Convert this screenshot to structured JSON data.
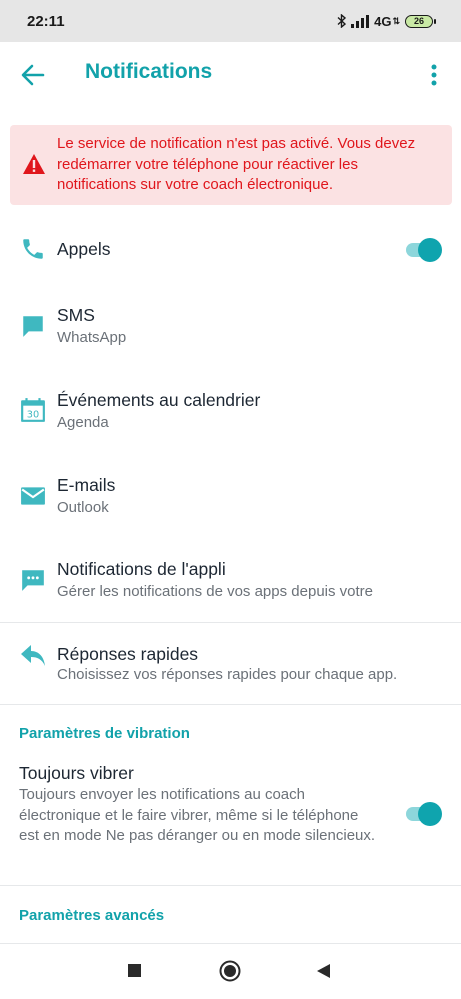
{
  "status": {
    "time": "22:11",
    "network": "4G",
    "battery": "26",
    "icons": [
      "bluetooth-icon",
      "signal-icon",
      "battery-icon"
    ]
  },
  "header": {
    "title": "Notifications",
    "back_icon": "arrow-back-icon",
    "menu_icon": "more-vert-icon"
  },
  "alert": {
    "text": "Le service de notification n'est pas activé. Vous devez redémarrer votre téléphone pour réactiver les notifications sur votre coach électronique.",
    "icon": "warning-icon",
    "color": "#e0161c",
    "background": "#fbe2e3"
  },
  "items": [
    {
      "label": "Appels",
      "sub": "",
      "icon": "phone-icon",
      "toggle": true
    },
    {
      "label": "SMS",
      "sub": "WhatsApp",
      "icon": "message-icon"
    },
    {
      "label": "Événements au calendrier",
      "sub": "Agenda",
      "icon": "calendar-icon",
      "icon_text": "30"
    },
    {
      "label": "E-mails",
      "sub": "Outlook",
      "icon": "email-icon"
    },
    {
      "label": "Notifications de l'appli",
      "sub": "Gérer les notifications de vos apps depuis votre",
      "icon": "chat-dots-icon"
    },
    {
      "label": "Réponses rapides",
      "sub": "Choisissez vos réponses rapides pour chaque app.",
      "icon": "reply-icon"
    }
  ],
  "vibration": {
    "section_title": "Paramètres de vibration",
    "label": "Toujours vibrer",
    "description": "Toujours envoyer les notifications au coach électronique et le faire vibrer, même si le téléphone est en mode Ne pas déranger ou en mode silencieux.",
    "toggle": true
  },
  "advanced": {
    "section_title": "Paramètres avancés"
  },
  "colors": {
    "accent": "#12a2aa",
    "toggle_on": "#0fa4ae",
    "text": "#1d2733",
    "subtext": "#6b7178"
  },
  "navbar": {
    "buttons": [
      "recents-square-icon",
      "home-circle-icon",
      "back-triangle-icon"
    ]
  }
}
